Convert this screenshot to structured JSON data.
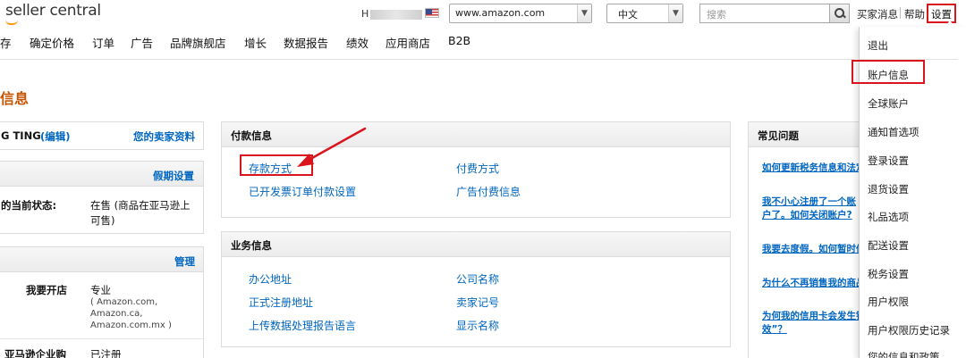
{
  "header": {
    "logo": "seller central",
    "merchant_initial": "H",
    "marketplace": "www.amazon.com",
    "language": "中文",
    "search_placeholder": "搜索",
    "messages": "买家消息",
    "help": "帮助",
    "settings": "设置"
  },
  "nav": [
    "存",
    "确定价格",
    "订单",
    "广告",
    "品牌旗舰店",
    "增长",
    "数据报告",
    "绩效",
    "应用商店",
    "B2B"
  ],
  "page_title": "信息",
  "left": {
    "seller_name": "G TING",
    "edit": "(编辑)",
    "seller_profile": "您的卖家资料",
    "vacation": "假期设置",
    "status_label": "的当前状态:",
    "status_value_1": "在售 (商品在亚马逊上",
    "status_value_2": "可售)",
    "manage": "管理",
    "open_store_label": "我要开店",
    "open_store_value": "专业",
    "open_store_sub_1": "( Amazon.com,",
    "open_store_sub_2": "Amazon.ca,",
    "open_store_sub_3": "Amazon.com.mx )",
    "business_label": "亚马逊企业购",
    "business_value": "已注册"
  },
  "payment": {
    "title": "付款信息",
    "deposit": "存款方式",
    "charge": "付费方式",
    "invoiced": "已开发票订单付款设置",
    "ads_billing": "广告付费信息"
  },
  "business": {
    "title": "业务信息",
    "office": "办公地址",
    "company": "公司名称",
    "legal_address": "正式注册地址",
    "seller_token": "卖家记号",
    "upload_language": "上传数据处理报告语言",
    "display_name": "显示名称"
  },
  "faq": {
    "title": "常见问题",
    "q1": "如何更新税务信息和法定",
    "q2a": "我不小心注册了一个账",
    "q2b": "户了。如何关闭账户?",
    "q3": "我要去度假。如何暂时停",
    "q4": "为什么不再销售我的商品",
    "q5a": "为何我的信用卡会发生错",
    "q5b": "效”？"
  },
  "dropdown": [
    "退出",
    "账户信息",
    "全球账户",
    "通知首选项",
    "登录设置",
    "退货设置",
    "礼品选项",
    "配送设置",
    "税务设置",
    "用户权限",
    "用户权限历史记录",
    "您的信息和政策"
  ]
}
